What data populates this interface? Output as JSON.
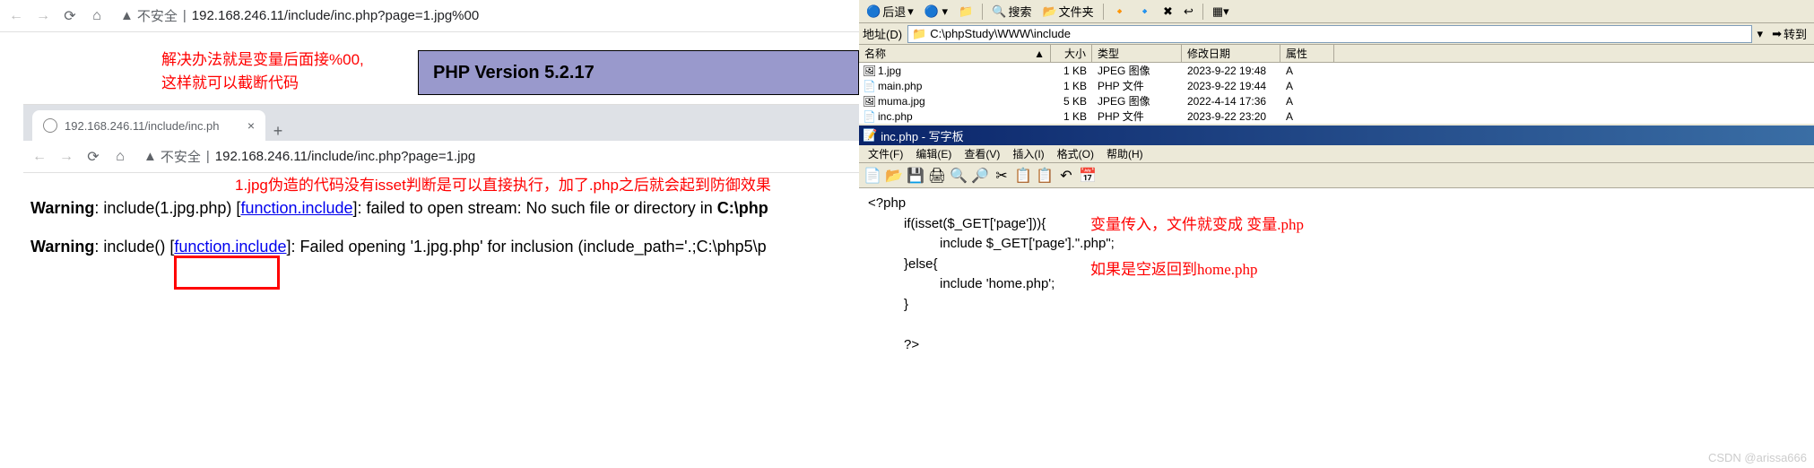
{
  "browser1": {
    "insecure_label": "不安全",
    "url": "192.168.246.11/include/inc.php?page=1.jpg%00",
    "php_banner": "PHP Version 5.2.17",
    "note_line1": "解决办法就是变量后面接%00,",
    "note_line2": "这样就可以截断代码"
  },
  "browser2": {
    "tab_title": "192.168.246.11/include/inc.ph",
    "insecure_label": "不安全",
    "url": "192.168.246.11/include/inc.php?page=1.jpg",
    "note": "1.jpg伪造的代码没有isset判断是可以直接执行，加了.php之后就会起到防御效果",
    "warn_label": "Warning",
    "warn1_a": ": include(1.jpg.php) [",
    "warn1_link": "function.include",
    "warn1_b": "]: failed to open stream: No such file or directory in ",
    "warn1_path": "C:\\php",
    "warn2_a": ": include() [",
    "warn2_link": "function.include",
    "warn2_b": "]: Failed opening '1.jpg.php' for inclusion (include_path='.;C:\\php5\\p"
  },
  "explorer": {
    "back": "后退",
    "search": "搜索",
    "folders": "文件夹",
    "addr_label": "地址(D)",
    "path": "C:\\phpStudy\\WWW\\include",
    "go": "转到",
    "cols": {
      "name": "名称",
      "size": "大小",
      "type": "类型",
      "date": "修改日期",
      "attr": "属性"
    },
    "files": [
      {
        "name": "1.jpg",
        "size": "1 KB",
        "type": "JPEG 图像",
        "date": "2023-9-22 19:48",
        "attr": "A"
      },
      {
        "name": "main.php",
        "size": "1 KB",
        "type": "PHP 文件",
        "date": "2023-9-22 19:44",
        "attr": "A"
      },
      {
        "name": "muma.jpg",
        "size": "5 KB",
        "type": "JPEG 图像",
        "date": "2022-4-14 17:36",
        "attr": "A"
      },
      {
        "name": "inc.php",
        "size": "1 KB",
        "type": "PHP 文件",
        "date": "2023-9-22 23:20",
        "attr": "A"
      }
    ]
  },
  "wordpad": {
    "title": "inc.php - 写字板",
    "menu": {
      "file": "文件(F)",
      "edit": "编辑(E)",
      "view": "查看(V)",
      "insert": "插入(I)",
      "format": "格式(O)",
      "help": "帮助(H)"
    },
    "code": {
      "l1": "<?php",
      "l2": "if(isset($_GET['page'])){",
      "l3": "include $_GET['page'].\".php\";",
      "l4": "}else{",
      "l5": "include 'home.php';",
      "l6": "}",
      "l7": "?>"
    },
    "note1": "变量传入，文件就变成 变量.php",
    "note2": "如果是空返回到home.php"
  },
  "watermark": "CSDN @arissa666"
}
